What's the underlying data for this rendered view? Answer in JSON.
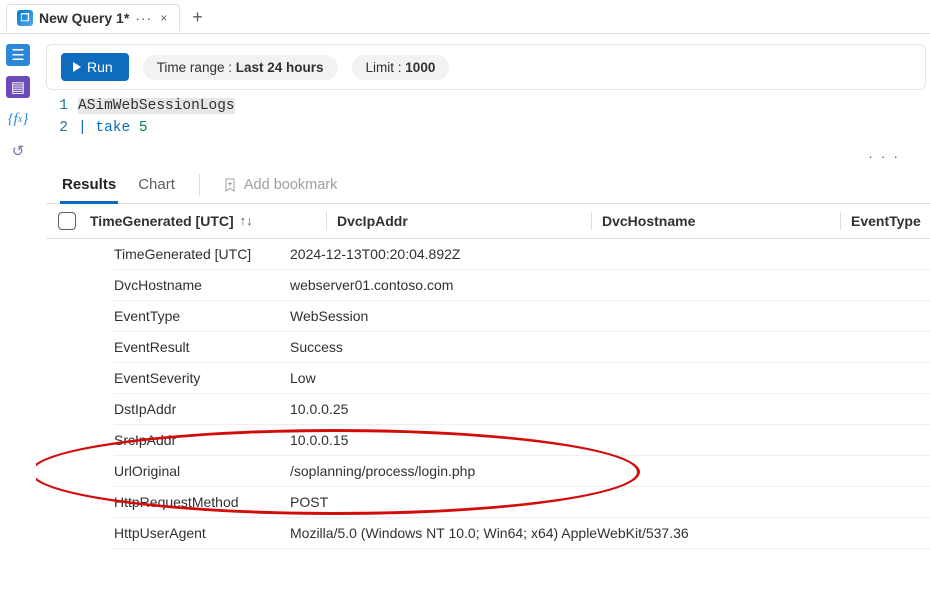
{
  "tab": {
    "title": "New Query 1*",
    "dots": "···",
    "close": "×",
    "new": "+"
  },
  "toolbar": {
    "run": "Run",
    "timeRangeLabel": "Time range :",
    "timeRangeValue": "Last 24 hours",
    "limitLabel": "Limit :",
    "limitValue": "1000"
  },
  "editor": {
    "lines": [
      {
        "n": "1",
        "raw": "ASimWebSessionLogs"
      },
      {
        "n": "2",
        "pipe": "|",
        "op": "take",
        "num": "5"
      }
    ]
  },
  "moreDots": "· · ·",
  "resultTabs": {
    "results": "Results",
    "chart": "Chart",
    "bookmark": "Add bookmark"
  },
  "columns": {
    "c1": "TimeGenerated [UTC]",
    "c2": "DvcIpAddr",
    "c3": "DvcHostname",
    "c4": "EventType"
  },
  "details": [
    {
      "k": "TimeGenerated [UTC]",
      "v": "2024-12-13T00:20:04.892Z"
    },
    {
      "k": "DvcHostname",
      "v": "webserver01.contoso.com"
    },
    {
      "k": "EventType",
      "v": "WebSession"
    },
    {
      "k": "EventResult",
      "v": "Success"
    },
    {
      "k": "EventSeverity",
      "v": "Low"
    },
    {
      "k": "DstIpAddr",
      "v": "10.0.0.25"
    },
    {
      "k": "SrcIpAddr",
      "v": "10.0.0.15"
    },
    {
      "k": "UrlOriginal",
      "v": "/soplanning/process/login.php"
    },
    {
      "k": "HttpRequestMethod",
      "v": "POST"
    },
    {
      "k": "HttpUserAgent",
      "v": "Mozilla/5.0 (Windows NT 10.0; Win64; x64) AppleWebKit/537.36"
    }
  ]
}
